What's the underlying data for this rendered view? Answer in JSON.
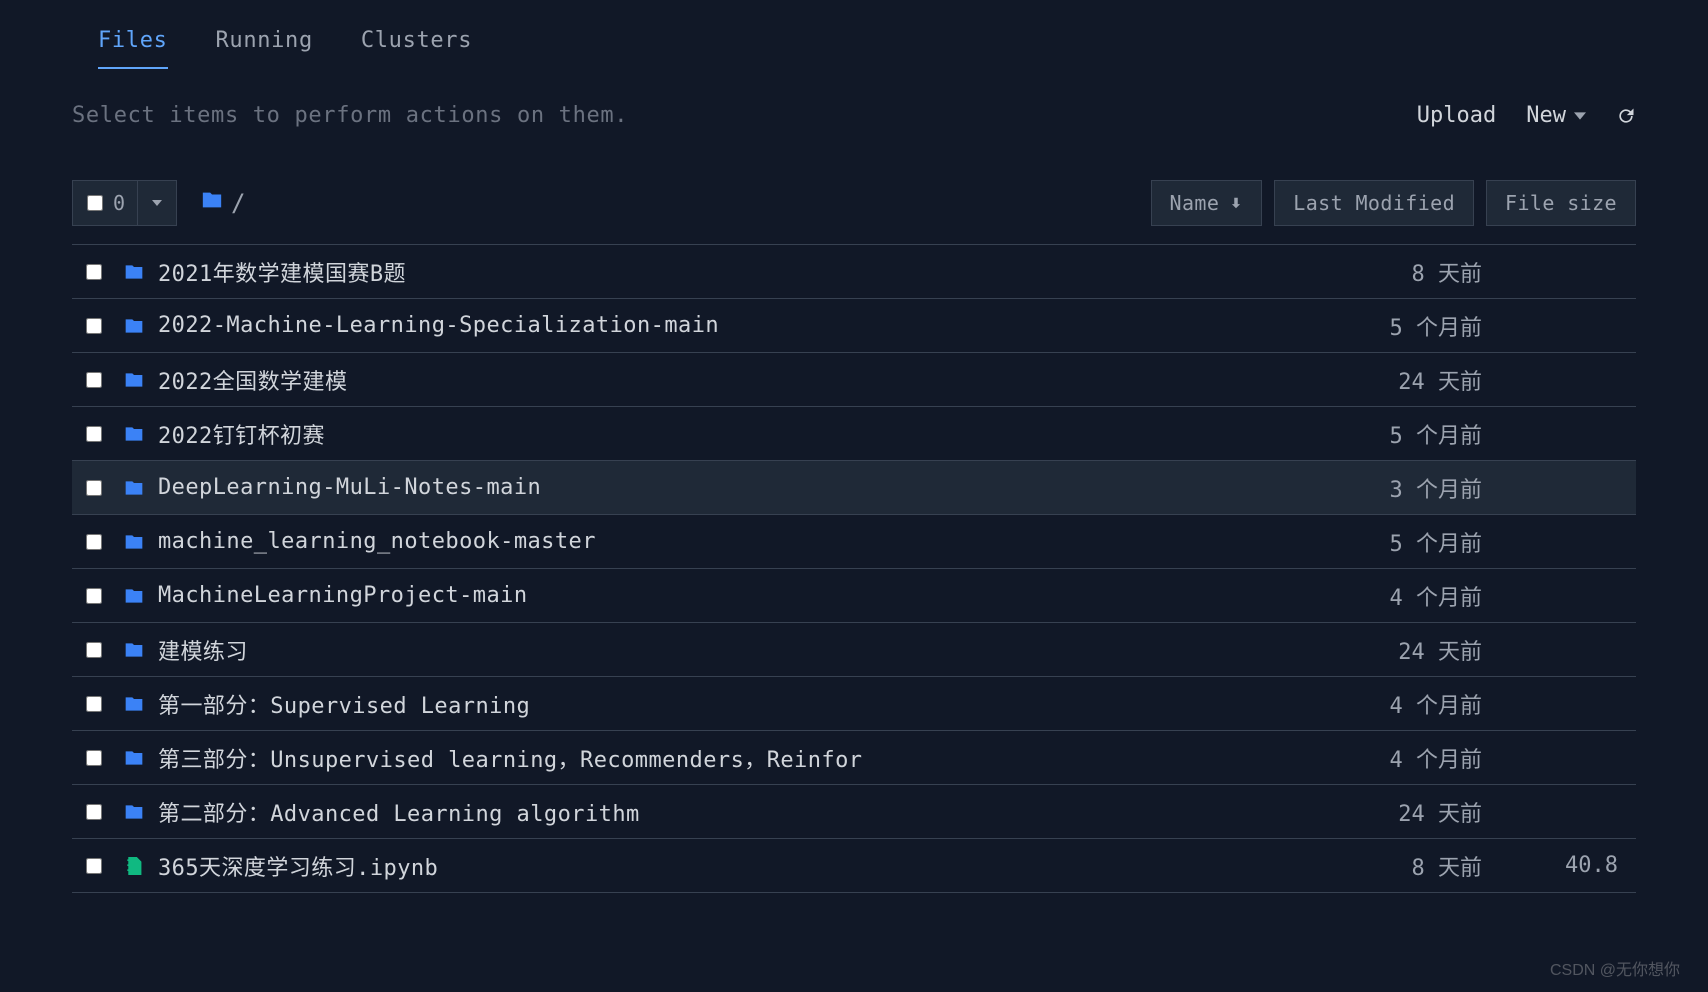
{
  "tabs": {
    "files": "Files",
    "running": "Running",
    "clusters": "Clusters"
  },
  "helper_text": "Select items to perform actions on them.",
  "actions": {
    "upload": "Upload",
    "new": "New"
  },
  "selector": {
    "count": "0"
  },
  "breadcrumb": {
    "path": "/"
  },
  "columns": {
    "name": "Name",
    "modified": "Last Modified",
    "size": "File size"
  },
  "files": [
    {
      "type": "folder",
      "name": "2021年数学建模国赛B题",
      "modified": "8 天前",
      "size": ""
    },
    {
      "type": "folder",
      "name": "2022-Machine-Learning-Specialization-main",
      "modified": "5 个月前",
      "size": ""
    },
    {
      "type": "folder",
      "name": "2022全国数学建模",
      "modified": "24 天前",
      "size": ""
    },
    {
      "type": "folder",
      "name": "2022钉钉杯初赛",
      "modified": "5 个月前",
      "size": ""
    },
    {
      "type": "folder",
      "name": "DeepLearning-MuLi-Notes-main",
      "modified": "3 个月前",
      "size": "",
      "hover": true
    },
    {
      "type": "folder",
      "name": "machine_learning_notebook-master",
      "modified": "5 个月前",
      "size": ""
    },
    {
      "type": "folder",
      "name": "MachineLearningProject-main",
      "modified": "4 个月前",
      "size": ""
    },
    {
      "type": "folder",
      "name": "建模练习",
      "modified": "24 天前",
      "size": ""
    },
    {
      "type": "folder",
      "name": "第一部分：Supervised Learning",
      "modified": "4 个月前",
      "size": ""
    },
    {
      "type": "folder",
      "name": "第三部分：Unsupervised learning，Recommenders，Reinfor",
      "modified": "4 个月前",
      "size": ""
    },
    {
      "type": "folder",
      "name": "第二部分：Advanced Learning algorithm",
      "modified": "24 天前",
      "size": ""
    },
    {
      "type": "notebook",
      "name": "365天深度学习练习.ipynb",
      "modified": "8 天前",
      "size": "40.8"
    }
  ],
  "watermark": "CSDN @无你想你"
}
